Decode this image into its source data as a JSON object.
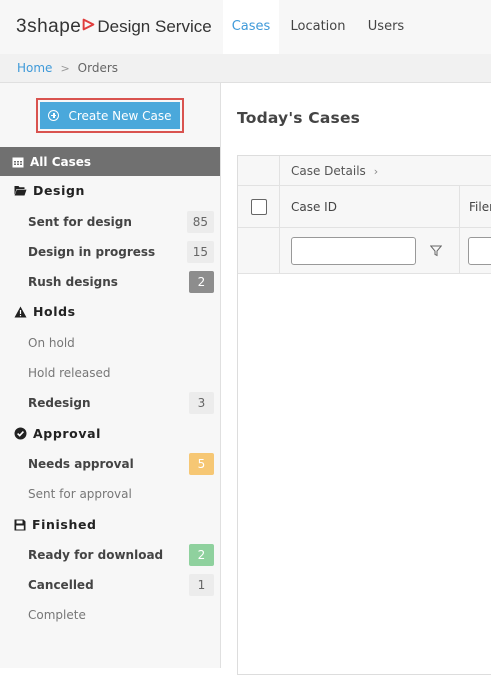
{
  "app": {
    "brand_prefix": "3shape",
    "brand_suffix": "Design Service"
  },
  "nav": {
    "tabs": [
      {
        "label": "Cases",
        "active": true
      },
      {
        "label": "Location",
        "active": false
      },
      {
        "label": "Users",
        "active": false
      }
    ]
  },
  "breadcrumb": {
    "home": "Home",
    "separator": ">",
    "current": "Orders"
  },
  "sidebar": {
    "create_button": "Create New Case",
    "all_cases": "All Cases",
    "sections": [
      {
        "title": "Design",
        "icon": "folder-open-icon",
        "items": [
          {
            "label": "Sent for design",
            "count": "85",
            "badge": "gray",
            "weight": "bold"
          },
          {
            "label": "Design in progress",
            "count": "15",
            "badge": "gray",
            "weight": "bold"
          },
          {
            "label": "Rush designs",
            "count": "2",
            "badge": "dark",
            "weight": "bold"
          }
        ]
      },
      {
        "title": "Holds",
        "icon": "warning-icon",
        "items": [
          {
            "label": "On hold",
            "count": "",
            "badge": "",
            "weight": "light"
          },
          {
            "label": "Hold released",
            "count": "",
            "badge": "",
            "weight": "light"
          },
          {
            "label": "Redesign",
            "count": "3",
            "badge": "gray",
            "weight": "bold"
          }
        ]
      },
      {
        "title": "Approval",
        "icon": "check-circle-icon",
        "items": [
          {
            "label": "Needs approval",
            "count": "5",
            "badge": "orange",
            "weight": "bold"
          },
          {
            "label": "Sent for approval",
            "count": "",
            "badge": "",
            "weight": "light"
          }
        ]
      },
      {
        "title": "Finished",
        "icon": "save-icon",
        "items": [
          {
            "label": "Ready for download",
            "count": "2",
            "badge": "green",
            "weight": "bold"
          },
          {
            "label": "Cancelled",
            "count": "1",
            "badge": "gray",
            "weight": "bold"
          },
          {
            "label": "Complete",
            "count": "",
            "badge": "",
            "weight": "light"
          }
        ]
      }
    ]
  },
  "main": {
    "title": "Today's Cases",
    "grid": {
      "group_header": "Case Details",
      "columns": [
        "Case ID",
        "Filen"
      ],
      "filter_value": ""
    }
  },
  "colors": {
    "accent": "#3f9ad9",
    "button": "#4aa8db",
    "highlight_border": "#d9534f",
    "all_cases_bg": "#707070"
  }
}
